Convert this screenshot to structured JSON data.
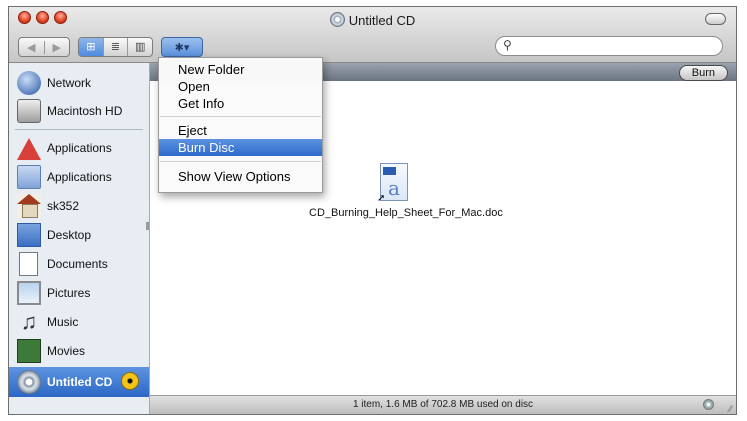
{
  "window": {
    "title": "Untitled CD"
  },
  "toolbar": {
    "back": "◀",
    "forward": "▶",
    "view_icon": "⊞",
    "view_list": "≣",
    "view_columns": "▥",
    "action": "✱▾",
    "search_placeholder": ""
  },
  "sidebar": {
    "items": [
      {
        "label": "Network",
        "icon": "network-globe-icon"
      },
      {
        "label": "Macintosh HD",
        "icon": "hard-drive-icon"
      },
      {
        "label": "Applications",
        "icon": "applications-icon"
      },
      {
        "label": "Applications",
        "icon": "folder-icon"
      },
      {
        "label": "sk352",
        "icon": "home-icon"
      },
      {
        "label": "Desktop",
        "icon": "desktop-icon"
      },
      {
        "label": "Documents",
        "icon": "documents-icon"
      },
      {
        "label": "Pictures",
        "icon": "pictures-icon"
      },
      {
        "label": "Music",
        "icon": "music-icon"
      },
      {
        "label": "Movies",
        "icon": "movies-icon"
      },
      {
        "label": "Untitled CD",
        "icon": "cd-icon",
        "selected": true
      }
    ]
  },
  "content": {
    "burn_button": "Burn",
    "file": {
      "name": "CD_Burning_Help_Sheet_For_Mac.doc"
    }
  },
  "action_menu": {
    "items": [
      {
        "label": "New Folder"
      },
      {
        "label": "Open"
      },
      {
        "label": "Get Info"
      },
      {
        "label": "Eject"
      },
      {
        "label": "Burn Disc",
        "highlighted": true
      },
      {
        "label": "Show View Options"
      }
    ]
  },
  "status": {
    "text": "1 item, 1.6 MB of 702.8 MB used on disc"
  },
  "colors": {
    "selection": "#2f6bd0",
    "sidebar": "#e8edf3"
  }
}
